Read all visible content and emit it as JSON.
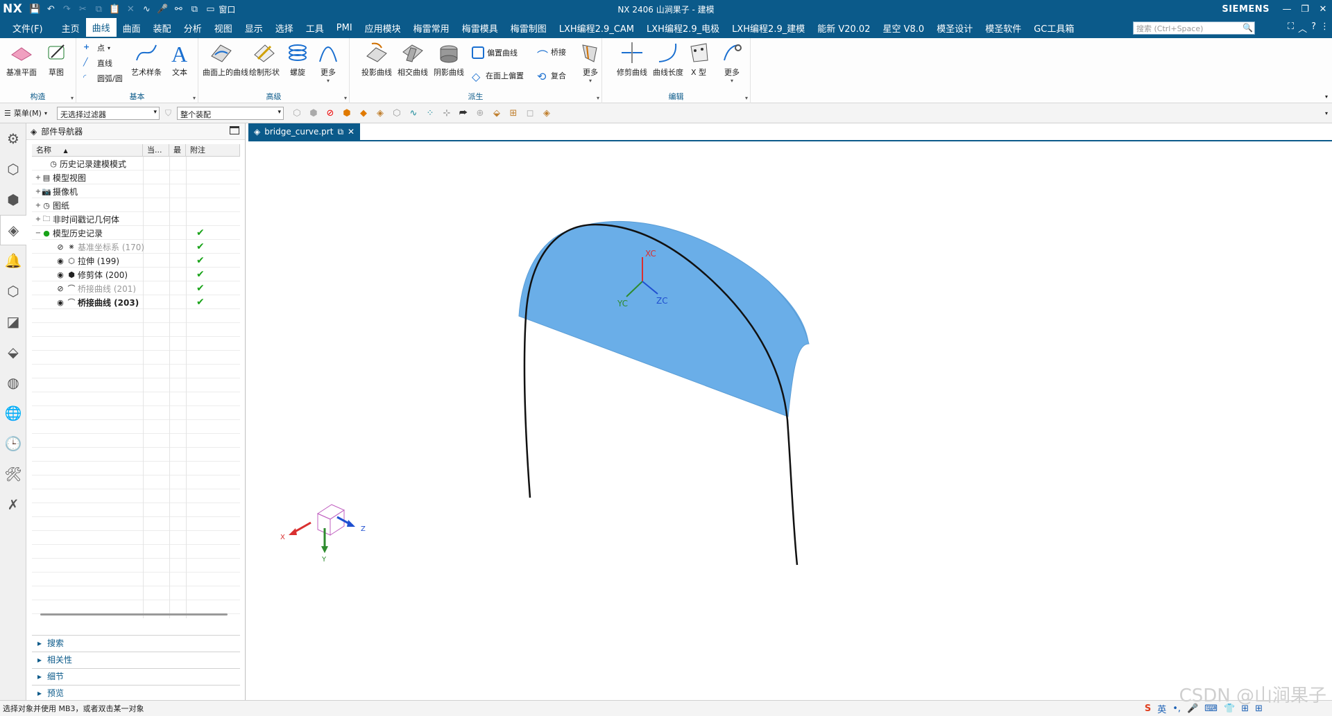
{
  "app": {
    "logo": "NX",
    "window_menu": "窗口",
    "title": "NX 2406 山涧果子 - 建模",
    "brand": "SIEMENS"
  },
  "menu": {
    "file": "文件(F)",
    "items": [
      "主页",
      "曲线",
      "曲面",
      "装配",
      "分析",
      "视图",
      "显示",
      "选择",
      "工具",
      "PMI",
      "应用模块",
      "梅雷常用",
      "梅雷模具",
      "梅雷制图",
      "LXH编程2.9_CAM",
      "LXH编程2.9_电极",
      "LXH编程2.9_建模",
      "能新 V20.02",
      "星空 V8.0",
      "模圣设计",
      "模圣软件",
      "GC工具箱"
    ],
    "active_index": 1,
    "search_placeholder": "搜索 (Ctrl+Space)"
  },
  "ribbon": {
    "groups": [
      {
        "label": "构造",
        "tools": [
          "基准平面",
          "草图"
        ]
      },
      {
        "label": "基本",
        "tools": [
          "点",
          "直线",
          "圆弧/圆",
          "艺术样条",
          "文本"
        ]
      },
      {
        "label": "高级",
        "tools": [
          "曲面上的曲线",
          "绘制形状",
          "螺旋",
          "更多"
        ]
      },
      {
        "label": "派生",
        "tools": [
          "投影曲线",
          "相交曲线",
          "阴影曲线",
          "偏置曲线",
          "桥接",
          "在面上偏置",
          "复合",
          "更多"
        ]
      },
      {
        "label": "编辑",
        "tools": [
          "修剪曲线",
          "曲线长度",
          "X 型",
          "更多"
        ]
      }
    ]
  },
  "selection_bar": {
    "menu_label": "菜单(M)",
    "filter": "无选择过滤器",
    "scope": "整个装配"
  },
  "navigator": {
    "title": "部件导航器",
    "columns": [
      "名称",
      "当...",
      "最",
      "附注"
    ],
    "rows": [
      {
        "label": "历史记录建模模式",
        "indent": 1,
        "state": "normal"
      },
      {
        "label": "模型视图",
        "indent": 0,
        "state": "normal"
      },
      {
        "label": "摄像机",
        "indent": 0,
        "state": "normal"
      },
      {
        "label": "图纸",
        "indent": 0,
        "state": "normal"
      },
      {
        "label": "非时间戳记几何体",
        "indent": 0,
        "state": "normal"
      },
      {
        "label": "模型历史记录",
        "indent": 0,
        "state": "normal"
      },
      {
        "label": "基准坐标系 (170)",
        "indent": 2,
        "state": "dim"
      },
      {
        "label": "拉伸 (199)",
        "indent": 2,
        "state": "normal"
      },
      {
        "label": "修剪体 (200)",
        "indent": 2,
        "state": "normal"
      },
      {
        "label": "桥接曲线 (201)",
        "indent": 2,
        "state": "dim"
      },
      {
        "label": "桥接曲线 (203)",
        "indent": 2,
        "state": "bold"
      }
    ],
    "panels": [
      "搜索",
      "相关性",
      "细节",
      "预览"
    ]
  },
  "tab": {
    "label": "bridge_curve.prt"
  },
  "viewport": {
    "axis_labels": {
      "xc": "XC",
      "yc": "YC",
      "zc": "ZC"
    },
    "triad_labels": {
      "x": "X",
      "y": "Y",
      "z": "Z"
    },
    "colors": {
      "surface": "#6aaee8",
      "axis_x": "#d93030",
      "axis_y": "#2e8b2e",
      "axis_z": "#1f4fd0",
      "cube": "#c060c0"
    }
  },
  "status": {
    "message": "选择对象并使用 MB3，或者双击某一对象",
    "watermark": "CSDN @山涧果子",
    "ime": "英"
  }
}
